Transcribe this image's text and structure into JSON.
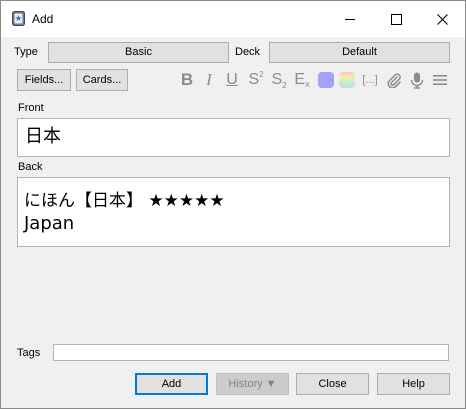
{
  "window": {
    "title": "Add",
    "minimize_icon": "minimize-icon",
    "maximize_icon": "maximize-icon",
    "close_icon": "close-icon"
  },
  "header": {
    "type_label": "Type",
    "type_value": "Basic",
    "deck_label": "Deck",
    "deck_value": "Default"
  },
  "toolbar": {
    "fields_label": "Fields...",
    "cards_label": "Cards...",
    "icons": [
      "bold-icon",
      "italic-icon",
      "underline-icon",
      "superscript-icon",
      "subscript-icon",
      "clear-format-icon",
      "text-color-icon",
      "highlight-color-icon",
      "cloze-icon",
      "attach-icon",
      "record-audio-icon",
      "more-options-icon"
    ],
    "bold": "B",
    "italic": "I",
    "underline": "U",
    "superscript": "S",
    "superscript_mark": "2",
    "subscript": "S",
    "subscript_mark": "2",
    "clear": "E",
    "clear_mark": "x",
    "cloze": "[...]",
    "text_color": "#a3a3f5",
    "highlight_colors": [
      "#f7c4c4",
      "#f5f0b0",
      "#c4f0c4",
      "#c4d8f7"
    ]
  },
  "fields": {
    "front_label": "Front",
    "front_value": "日本",
    "back_label": "Back",
    "back_line1": "にほん【日本】 ★★★★★",
    "back_line2": "Japan"
  },
  "tags": {
    "label": "Tags",
    "value": ""
  },
  "buttons": {
    "add": "Add",
    "history": "History ▼",
    "close": "Close",
    "help": "Help"
  }
}
